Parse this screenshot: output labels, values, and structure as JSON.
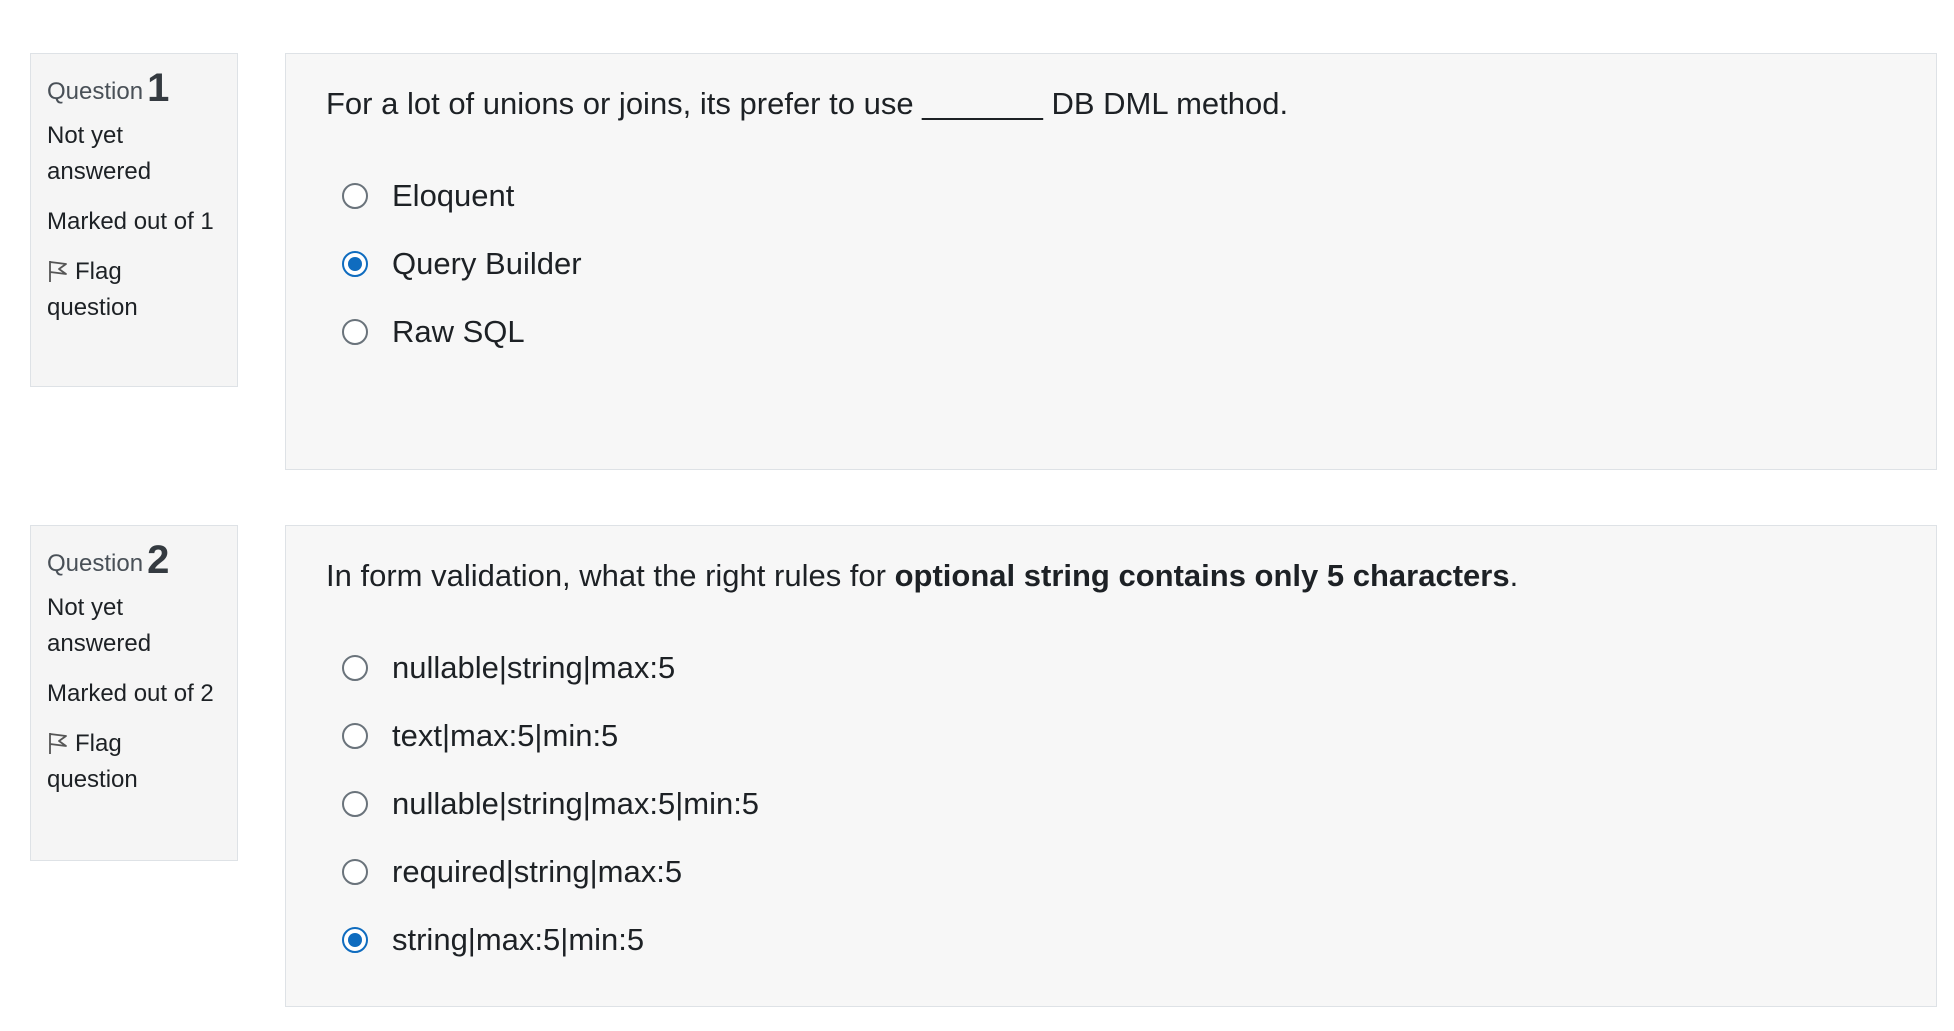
{
  "questions": [
    {
      "label": "Question",
      "number": "1",
      "state": "Not yet answered",
      "grade": "Marked out of 1",
      "flag": "Flag question",
      "text": "For a lot of unions or joins, its prefer to use _______ DB DML method.",
      "options": [
        {
          "label": "Eloquent",
          "checked": false
        },
        {
          "label": "Query Builder",
          "checked": true
        },
        {
          "label": "Raw SQL",
          "checked": false
        }
      ]
    },
    {
      "label": "Question",
      "number": "2",
      "state": "Not yet answered",
      "grade": "Marked out of 2",
      "flag": "Flag question",
      "text_prefix": "In form validation, what the right rules for ",
      "text_bold": "optional string contains only 5 characters",
      "text_suffix": ".",
      "options": [
        {
          "label": "nullable|string|max:5",
          "checked": false
        },
        {
          "label": "text|max:5|min:5",
          "checked": false
        },
        {
          "label": "nullable|string|max:5|min:5",
          "checked": false
        },
        {
          "label": "required|string|max:5",
          "checked": false
        },
        {
          "label": "string|max:5|min:5",
          "checked": true
        }
      ]
    }
  ]
}
